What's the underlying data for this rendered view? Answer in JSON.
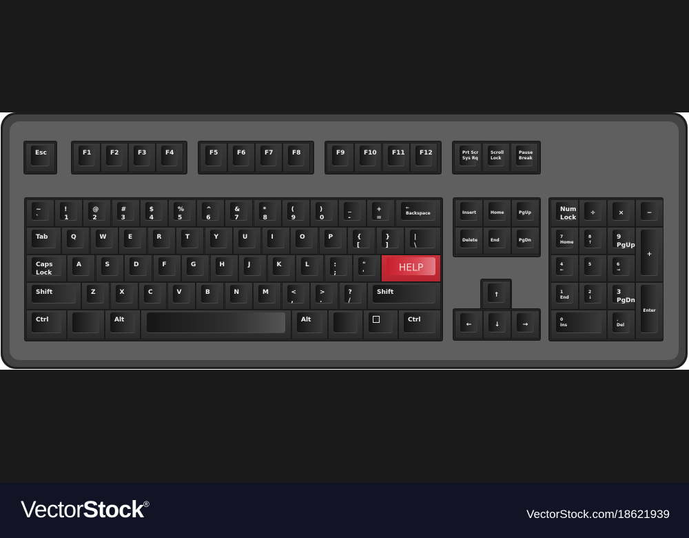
{
  "keyboard": {
    "help_key_color": "#c8202c",
    "case_color": "#5f5f5f",
    "key_color": "#2a2a2a",
    "function_row": [
      {
        "id": "esc",
        "label": "Esc"
      },
      {
        "id": "f1",
        "label": "F1"
      },
      {
        "id": "f2",
        "label": "F2"
      },
      {
        "id": "f3",
        "label": "F3"
      },
      {
        "id": "f4",
        "label": "F4"
      },
      {
        "id": "f5",
        "label": "F5"
      },
      {
        "id": "f6",
        "label": "F6"
      },
      {
        "id": "f7",
        "label": "F7"
      },
      {
        "id": "f8",
        "label": "F8"
      },
      {
        "id": "f9",
        "label": "F9"
      },
      {
        "id": "f10",
        "label": "F10"
      },
      {
        "id": "f11",
        "label": "F11"
      },
      {
        "id": "f12",
        "label": "F12"
      },
      {
        "id": "prtscr",
        "label": "Prt Scr\nSys Rq"
      },
      {
        "id": "scrolllock",
        "label": "Scroll\nLock"
      },
      {
        "id": "pausebreak",
        "label": "Pause\nBreak"
      }
    ],
    "number_row": [
      {
        "id": "backtick",
        "label": "~\n`"
      },
      {
        "id": "1",
        "label": "!\n1"
      },
      {
        "id": "2",
        "label": "@\n2"
      },
      {
        "id": "3",
        "label": "#\n3"
      },
      {
        "id": "4",
        "label": "$\n4"
      },
      {
        "id": "5",
        "label": "%\n5"
      },
      {
        "id": "6",
        "label": "^\n6"
      },
      {
        "id": "7",
        "label": "&\n7"
      },
      {
        "id": "8",
        "label": "*\n8"
      },
      {
        "id": "9",
        "label": "(\n9"
      },
      {
        "id": "0",
        "label": ")\n0"
      },
      {
        "id": "minus",
        "label": "_\n-"
      },
      {
        "id": "equals",
        "label": "+\n="
      },
      {
        "id": "backspace",
        "label": "←\nBackspace"
      }
    ],
    "top_row": [
      {
        "id": "tab",
        "label": "Tab"
      },
      {
        "id": "q",
        "label": "Q"
      },
      {
        "id": "w",
        "label": "W"
      },
      {
        "id": "e",
        "label": "E"
      },
      {
        "id": "r",
        "label": "R"
      },
      {
        "id": "t",
        "label": "T"
      },
      {
        "id": "y",
        "label": "Y"
      },
      {
        "id": "u",
        "label": "U"
      },
      {
        "id": "i",
        "label": "I"
      },
      {
        "id": "o",
        "label": "O"
      },
      {
        "id": "p",
        "label": "P"
      },
      {
        "id": "lbracket",
        "label": "{\n["
      },
      {
        "id": "rbracket",
        "label": "}\n]"
      },
      {
        "id": "backslash",
        "label": "|\n\\"
      }
    ],
    "home_row": [
      {
        "id": "capslock",
        "label": "Caps\nLock"
      },
      {
        "id": "a",
        "label": "A"
      },
      {
        "id": "s",
        "label": "S"
      },
      {
        "id": "d",
        "label": "D"
      },
      {
        "id": "f",
        "label": "F"
      },
      {
        "id": "g",
        "label": "G"
      },
      {
        "id": "h",
        "label": "H"
      },
      {
        "id": "j",
        "label": "J"
      },
      {
        "id": "k",
        "label": "K"
      },
      {
        "id": "l",
        "label": "L"
      },
      {
        "id": "semicolon",
        "label": ":\n;"
      },
      {
        "id": "quote",
        "label": "\"\n'"
      },
      {
        "id": "help",
        "label": "HELP"
      }
    ],
    "bottom_row": [
      {
        "id": "lshift",
        "label": "Shift"
      },
      {
        "id": "z",
        "label": "Z"
      },
      {
        "id": "x",
        "label": "X"
      },
      {
        "id": "c",
        "label": "C"
      },
      {
        "id": "v",
        "label": "V"
      },
      {
        "id": "b",
        "label": "B"
      },
      {
        "id": "n",
        "label": "N"
      },
      {
        "id": "m",
        "label": "M"
      },
      {
        "id": "comma",
        "label": "<\n,"
      },
      {
        "id": "period",
        "label": ">\n."
      },
      {
        "id": "slash",
        "label": "?\n/"
      },
      {
        "id": "rshift",
        "label": "Shift"
      }
    ],
    "space_row": [
      {
        "id": "lctrl",
        "label": "Ctrl"
      },
      {
        "id": "lwin",
        "label": ""
      },
      {
        "id": "lalt",
        "label": "Alt"
      },
      {
        "id": "space",
        "label": ""
      },
      {
        "id": "ralt",
        "label": "Alt"
      },
      {
        "id": "rwin",
        "label": ""
      },
      {
        "id": "menu",
        "label": "☐"
      },
      {
        "id": "rctrl",
        "label": "Ctrl"
      }
    ],
    "nav_cluster": [
      {
        "id": "insert",
        "label": "Insert"
      },
      {
        "id": "home",
        "label": "Home"
      },
      {
        "id": "pgup",
        "label": "PgUp"
      },
      {
        "id": "delete",
        "label": "Delete"
      },
      {
        "id": "end",
        "label": "End"
      },
      {
        "id": "pgdn",
        "label": "PgDn"
      }
    ],
    "arrows": [
      {
        "id": "up",
        "label": "↑"
      },
      {
        "id": "left",
        "label": "←"
      },
      {
        "id": "down",
        "label": "↓"
      },
      {
        "id": "right",
        "label": "→"
      }
    ],
    "numpad": [
      {
        "id": "numlock",
        "label": "Num\nLock"
      },
      {
        "id": "divide",
        "label": "÷"
      },
      {
        "id": "multiply",
        "label": "×"
      },
      {
        "id": "subtract",
        "label": "−"
      },
      {
        "id": "num7",
        "label": "7\nHome"
      },
      {
        "id": "num8",
        "label": "8\n↑"
      },
      {
        "id": "num9",
        "label": "9\nPgUp"
      },
      {
        "id": "add",
        "label": "+"
      },
      {
        "id": "num4",
        "label": "4\n←"
      },
      {
        "id": "num5",
        "label": "5"
      },
      {
        "id": "num6",
        "label": "6\n→"
      },
      {
        "id": "num1",
        "label": "1\nEnd"
      },
      {
        "id": "num2",
        "label": "2\n↓"
      },
      {
        "id": "num3",
        "label": "3\nPgDn"
      },
      {
        "id": "enter",
        "label": "Enter"
      },
      {
        "id": "num0",
        "label": "0\nIns"
      },
      {
        "id": "decimal",
        "label": ".\nDel"
      }
    ]
  },
  "footer": {
    "brand_light": "Vector",
    "brand_bold": "Stock",
    "brand_mark": "®",
    "stock_id": "VectorStock.com/18621939"
  }
}
